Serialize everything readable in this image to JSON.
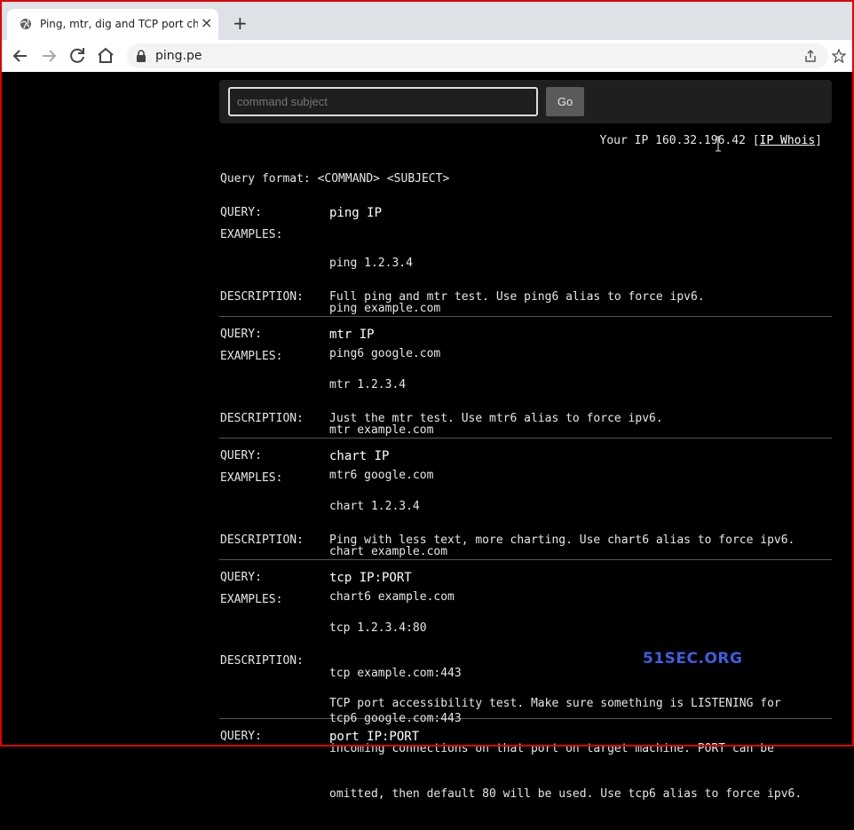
{
  "browser": {
    "tab_title": "Ping, mtr, dig and TCP port check",
    "new_tab_label": "+",
    "close_label": "×",
    "url": "ping.pe"
  },
  "search": {
    "placeholder": "command subject",
    "go_label": "Go"
  },
  "ip_info": {
    "prefix": "Your IP 160.32.196.42 [",
    "whois_label": "IP Whois",
    "suffix": "]"
  },
  "query_format": "Query format: <COMMAND> <SUBJECT>",
  "labels": {
    "query": "QUERY:",
    "examples": "EXAMPLES:",
    "description": "DESCRIPTION:"
  },
  "commands": [
    {
      "query": "ping IP",
      "examples": [
        "ping 1.2.3.4",
        "ping example.com",
        "ping6 google.com"
      ],
      "description": [
        "Full ping and mtr test. Use ping6 alias to force ipv6."
      ]
    },
    {
      "query": "mtr IP",
      "examples": [
        "mtr 1.2.3.4",
        "mtr example.com",
        "mtr6 google.com"
      ],
      "description": [
        "Just the mtr test. Use mtr6 alias to force ipv6."
      ]
    },
    {
      "query": "chart IP",
      "examples": [
        "chart 1.2.3.4",
        "chart example.com",
        "chart6 example.com"
      ],
      "description": [
        "Ping with less text, more charting. Use chart6 alias to force ipv6."
      ]
    },
    {
      "query": "tcp IP:PORT",
      "examples": [
        "tcp 1.2.3.4:80",
        "tcp example.com:443",
        "tcp6 google.com:443"
      ],
      "description": [
        "TCP port accessibility test. Make sure something is LISTENING for",
        "incoming connections on that port on target machine. PORT can be",
        "omitted, then default 80 will be used. Use tcp6 alias to force ipv6."
      ]
    },
    {
      "query": "port IP:PORT",
      "examples": [],
      "description": []
    }
  ],
  "watermark": "51SEC.ORG",
  "colors": {
    "page_bg": "#000000",
    "text": "#e6e6e6",
    "frame": "#e00000",
    "watermark": "#3d5fe0"
  }
}
